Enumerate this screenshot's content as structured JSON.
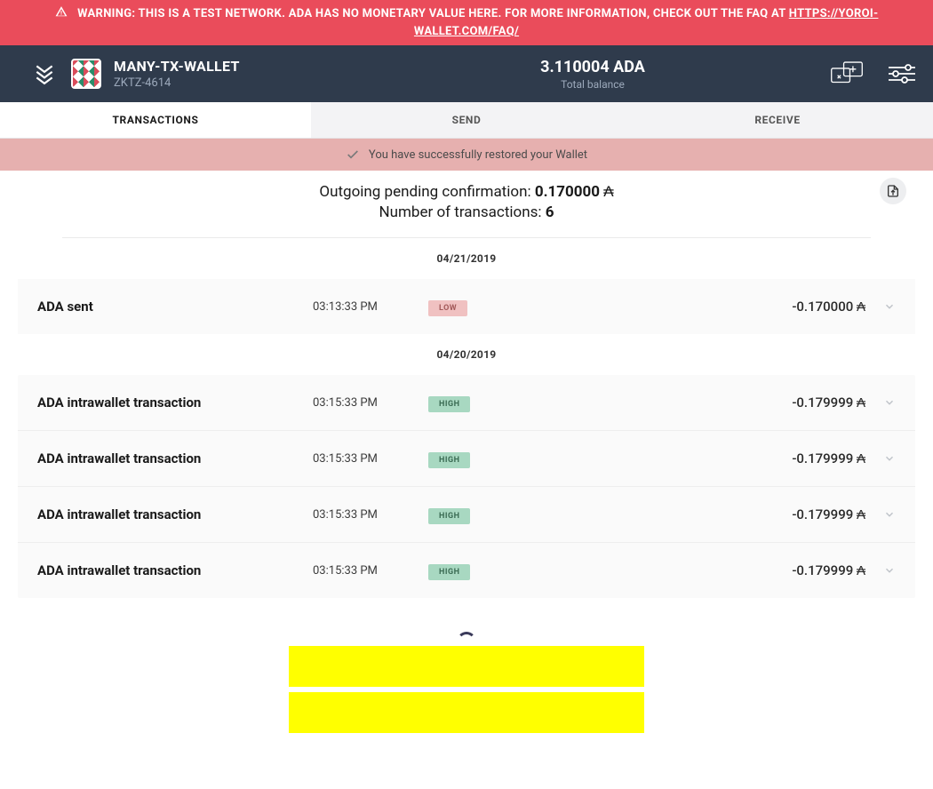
{
  "warning": {
    "text": "WARNING: THIS IS A TEST NETWORK. ADA HAS NO MONETARY VALUE HERE. FOR MORE INFORMATION, CHECK OUT THE FAQ AT ",
    "link_text": "HTTPS://YOROI-WALLET.COM/FAQ/"
  },
  "wallet": {
    "name": "MANY-TX-WALLET",
    "hash": "ZKTZ-4614",
    "balance_value": "3.110004 ADA",
    "balance_label": "Total balance"
  },
  "tabs": {
    "transactions": "TRANSACTIONS",
    "send": "SEND",
    "receive": "RECEIVE"
  },
  "toast": {
    "text": "You have successfully restored your Wallet"
  },
  "summary": {
    "pending_label": "Outgoing pending confirmation: ",
    "pending_value": "0.170000",
    "ada_symbol": "₳",
    "count_label": "Number of transactions: ",
    "count_value": "6"
  },
  "groups": [
    {
      "date": "04/21/2019",
      "rows": [
        {
          "title": "ADA sent",
          "time": "03:13:33 PM",
          "badge": "LOW",
          "badge_class": "badge-low",
          "amount": "-0.170000 ₳"
        }
      ]
    },
    {
      "date": "04/20/2019",
      "rows": [
        {
          "title": "ADA intrawallet transaction",
          "time": "03:15:33 PM",
          "badge": "HIGH",
          "badge_class": "badge-high",
          "amount": "-0.179999 ₳"
        },
        {
          "title": "ADA intrawallet transaction",
          "time": "03:15:33 PM",
          "badge": "HIGH",
          "badge_class": "badge-high",
          "amount": "-0.179999 ₳"
        },
        {
          "title": "ADA intrawallet transaction",
          "time": "03:15:33 PM",
          "badge": "HIGH",
          "badge_class": "badge-high",
          "amount": "-0.179999 ₳"
        },
        {
          "title": "ADA intrawallet transaction",
          "time": "03:15:33 PM",
          "badge": "HIGH",
          "badge_class": "badge-high",
          "amount": "-0.179999 ₳"
        }
      ]
    }
  ]
}
